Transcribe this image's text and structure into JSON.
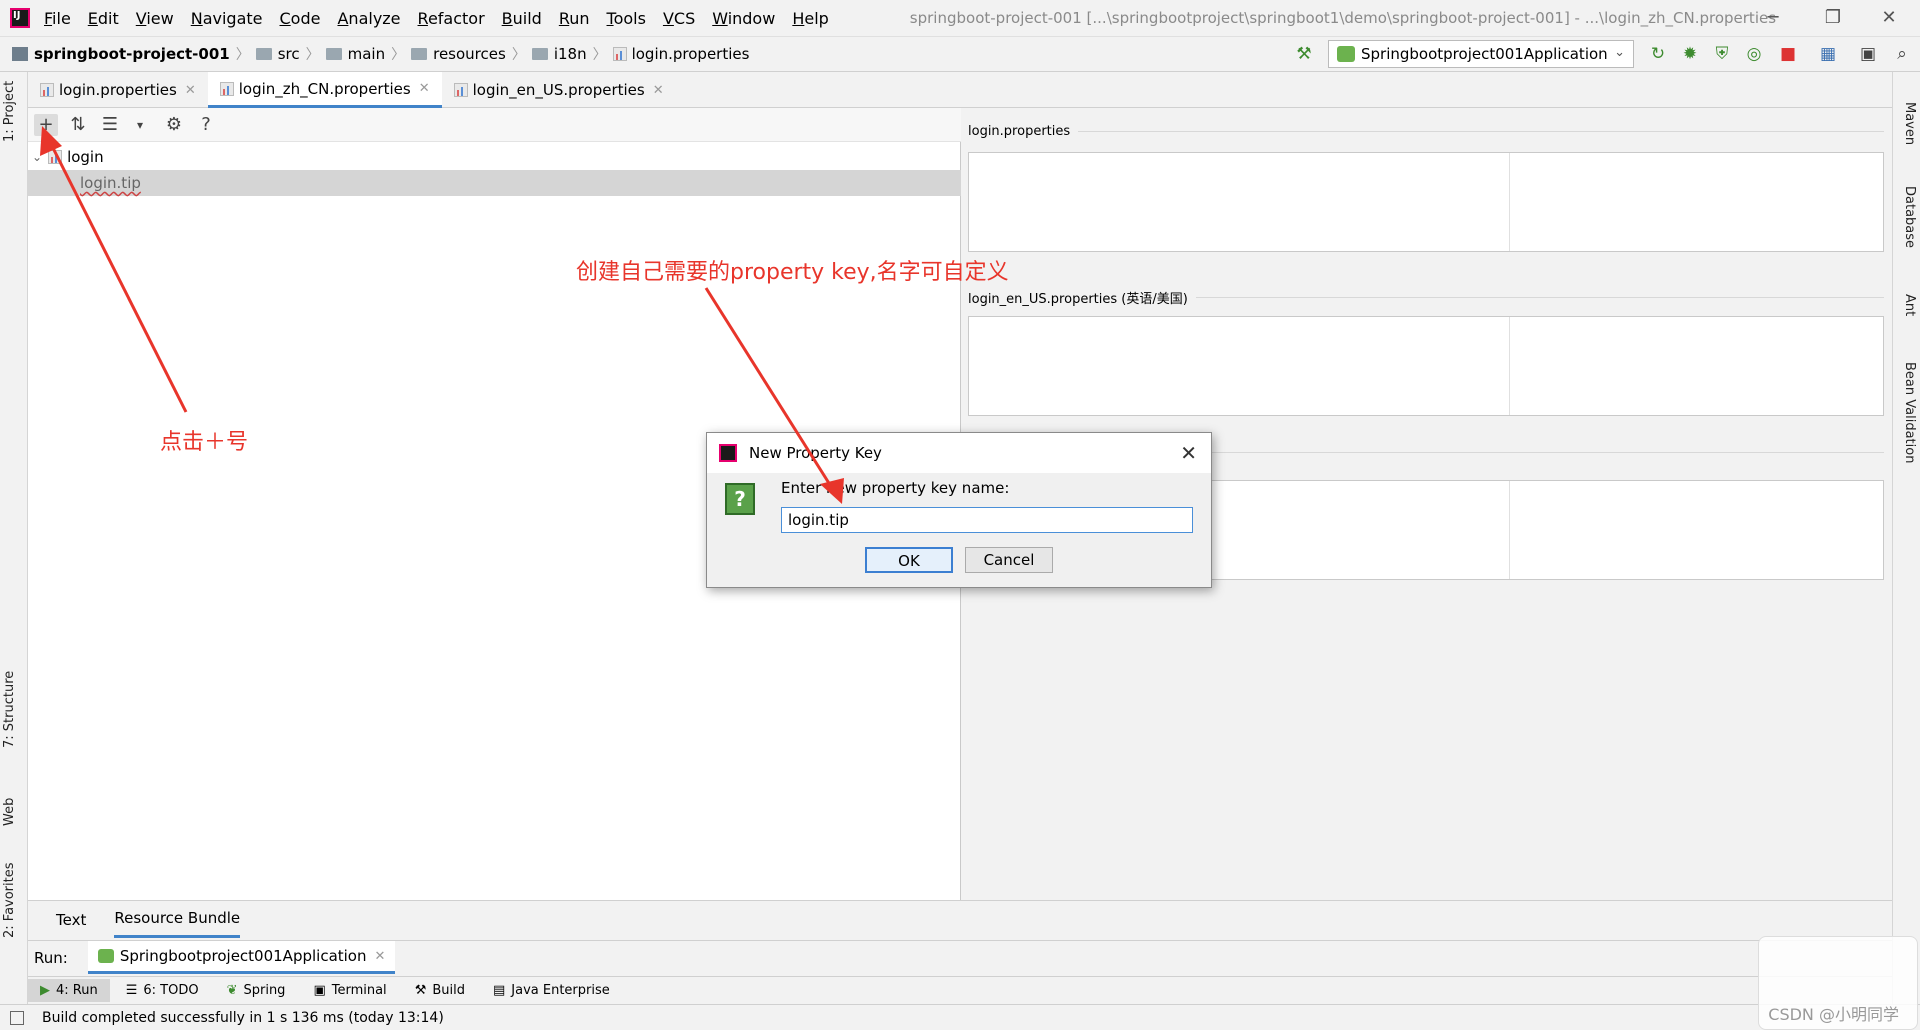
{
  "menu": [
    "File",
    "Edit",
    "View",
    "Navigate",
    "Code",
    "Analyze",
    "Refactor",
    "Build",
    "Run",
    "Tools",
    "VCS",
    "Window",
    "Help"
  ],
  "window_title": "springboot-project-001 [...\\springbootproject\\springboot1\\demo\\springboot-project-001] - ...\\login_zh_CN.properties",
  "window_controls": {
    "minimize": "─",
    "restore": "❐",
    "close": "✕"
  },
  "breadcrumb": {
    "project": "springboot-project-001",
    "src": "src",
    "main": "main",
    "resources": "resources",
    "i18n": "i18n",
    "file": "login.properties"
  },
  "run_config": "Springbootproject001Application",
  "editor_tabs": [
    {
      "label": "login.properties"
    },
    {
      "label": "login_zh_CN.properties"
    },
    {
      "label": "login_en_US.properties"
    }
  ],
  "left_stripe": {
    "project": "1: Project",
    "structure": "7: Structure",
    "web": "Web",
    "favorites": "2: Favorites"
  },
  "right_stripe": {
    "maven": "Maven",
    "database": "Database",
    "ant": "Ant",
    "bean": "Bean Validation"
  },
  "tree": {
    "root": "login",
    "selected_key": "login.tip"
  },
  "right_sections": [
    {
      "label": "login.properties"
    },
    {
      "label": "login_en_US.properties (英语/美国)"
    }
  ],
  "view_tabs": {
    "text": "Text",
    "bundle": "Resource Bundle"
  },
  "run_bar": {
    "label": "Run:",
    "tab": "Springbootproject001Application"
  },
  "tool_windows": [
    "4: Run",
    "6: TODO",
    "Spring",
    "Terminal",
    "Build",
    "Java Enterprise"
  ],
  "status": "Build completed successfully in 1 s 136 ms (today 13:14)",
  "dialog": {
    "title": "New Property Key",
    "prompt": "Enter new property key name:",
    "value": "login.tip",
    "ok": "OK",
    "cancel": "Cancel"
  },
  "annotations": {
    "click_plus": "点击＋号",
    "create_key": "创建自己需要的property key,名字可自定义"
  },
  "watermark": "CSDN @小明同学"
}
